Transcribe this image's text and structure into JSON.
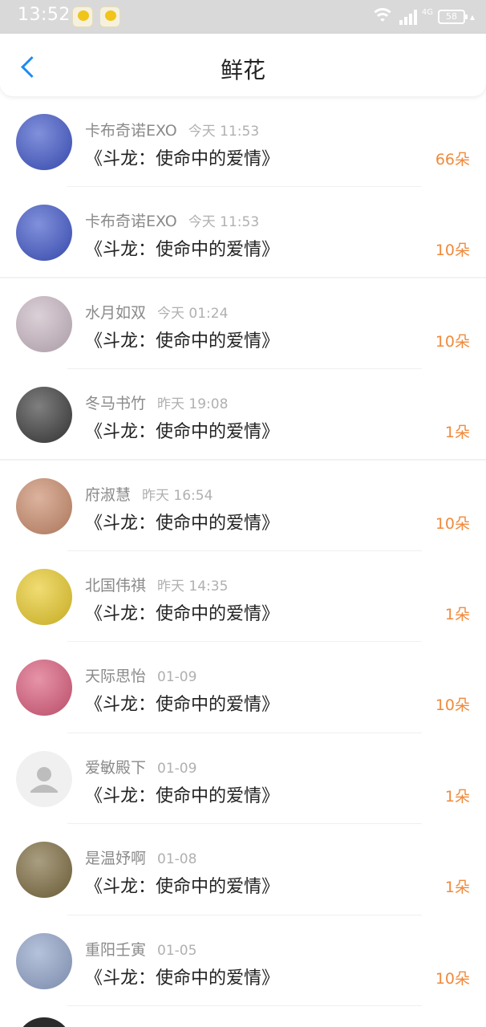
{
  "status_bar": {
    "time": "13:52",
    "network": "4G",
    "battery": "58"
  },
  "header": {
    "title": "鲜花"
  },
  "gifts": [
    {
      "name": "卡布奇诺EXO",
      "time": "今天 11:53",
      "title": "《斗龙：使命中的爱情》",
      "count": "66朵",
      "avatar_color": "#3e55c8"
    },
    {
      "name": "卡布奇诺EXO",
      "time": "今天 11:53",
      "title": "《斗龙：使命中的爱情》",
      "count": "10朵",
      "avatar_color": "#3e55c8"
    },
    {
      "name": "水月如双",
      "time": "今天 01:24",
      "title": "《斗龙：使命中的爱情》",
      "count": "10朵",
      "avatar_color": "#c9b7c2"
    },
    {
      "name": "冬马书竹",
      "time": "昨天 19:08",
      "title": "《斗龙：使命中的爱情》",
      "count": "1朵",
      "avatar_color": "#3a3a3a"
    },
    {
      "name": "府淑慧",
      "time": "昨天 16:54",
      "title": "《斗龙：使命中的爱情》",
      "count": "10朵",
      "avatar_color": "#c98a6a"
    },
    {
      "name": "北国伟祺",
      "time": "昨天 14:35",
      "title": "《斗龙：使命中的爱情》",
      "count": "1朵",
      "avatar_color": "#e8c928"
    },
    {
      "name": "天际思怡",
      "time": "01-09",
      "title": "《斗龙：使命中的爱情》",
      "count": "10朵",
      "avatar_color": "#d95a7a"
    },
    {
      "name": "爱敏殿下",
      "time": "01-09",
      "title": "《斗龙：使命中的爱情》",
      "count": "1朵",
      "avatar_color": "#f0f0f0"
    },
    {
      "name": "是温妤啊",
      "time": "01-08",
      "title": "《斗龙：使命中的爱情》",
      "count": "1朵",
      "avatar_color": "#7b6a3e"
    },
    {
      "name": "重阳壬寅",
      "time": "01-05",
      "title": "《斗龙：使命中的爱情》",
      "count": "10朵",
      "avatar_color": "#8fa2c8"
    }
  ]
}
